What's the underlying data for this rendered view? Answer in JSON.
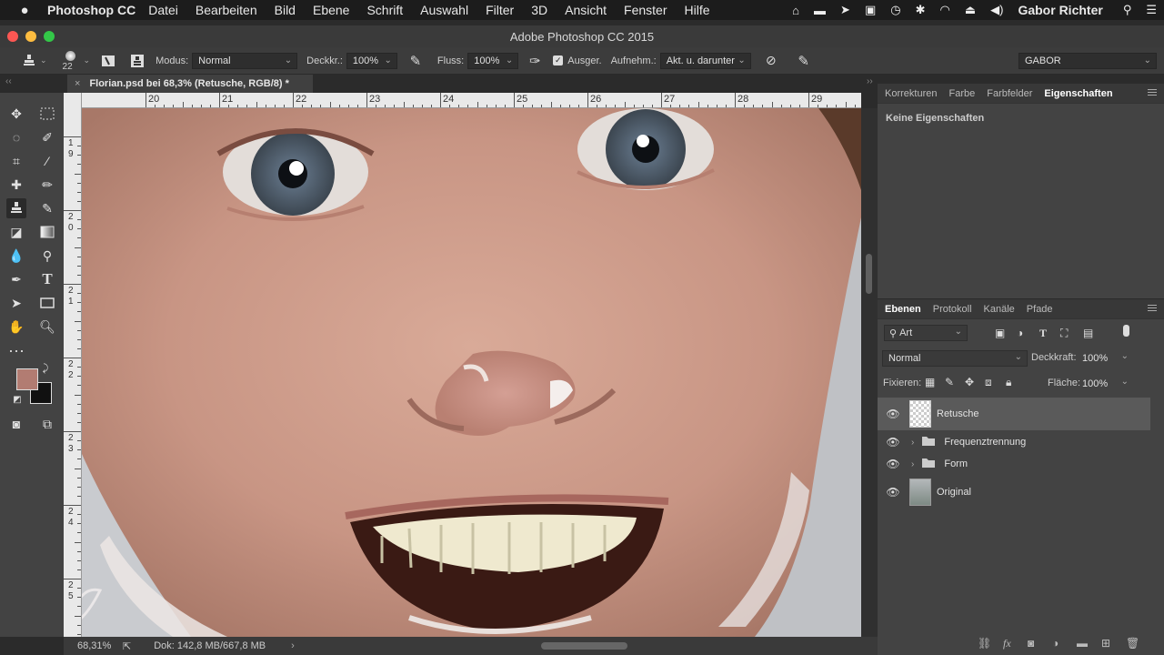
{
  "macmenu": {
    "apple": "",
    "app": "Photoshop CC",
    "items": [
      "Datei",
      "Bearbeiten",
      "Bild",
      "Ebene",
      "Schrift",
      "Auswahl",
      "Filter",
      "3D",
      "Ansicht",
      "Fenster",
      "Hilfe"
    ],
    "user": "Gabor Richter"
  },
  "window": {
    "title": "Adobe Photoshop CC 2015"
  },
  "options": {
    "brush_size": "22",
    "mode_label": "Modus:",
    "mode_value": "Normal",
    "opacity_label": "Deckkr.:",
    "opacity_value": "100%",
    "flow_label": "Fluss:",
    "flow_value": "100%",
    "aligned_label": "Ausger.",
    "sample_label": "Aufnehm.:",
    "sample_value": "Akt. u. darunter",
    "workspace": "GABOR"
  },
  "document": {
    "tab": "Florian.psd bei 68,3% (Retusche, RGB/8) *"
  },
  "ruler": {
    "top": [
      "20",
      "21",
      "22",
      "23",
      "24",
      "25",
      "26",
      "27",
      "28",
      "29"
    ],
    "left": [
      "1 9",
      "2 0",
      "2 1",
      "2 2",
      "2 3",
      "2 4",
      "2 5"
    ]
  },
  "status": {
    "zoom": "68,31%",
    "doc": "Dok: 142,8 MB/667,8 MB"
  },
  "properties": {
    "tabs": [
      "Korrekturen",
      "Farbe",
      "Farbfelder",
      "Eigenschaften"
    ],
    "active_tab": "Eigenschaften",
    "empty": "Keine Eigenschaften"
  },
  "layers": {
    "tabs": [
      "Ebenen",
      "Protokoll",
      "Kanäle",
      "Pfade"
    ],
    "active_tab": "Ebenen",
    "filter": "Art",
    "blend": "Normal",
    "opacity_label": "Deckkraft:",
    "opacity_value": "100%",
    "lock_label": "Fixieren:",
    "fill_label": "Fläche:",
    "fill_value": "100%",
    "items": [
      {
        "name": "Retusche",
        "type": "layer",
        "selected": true
      },
      {
        "name": "Frequenztrennung",
        "type": "group"
      },
      {
        "name": "Form",
        "type": "group"
      },
      {
        "name": "Original",
        "type": "smart"
      }
    ]
  },
  "colors": {
    "foreground": "#b27c72",
    "background": "#111111",
    "accent_selected": "#5a5a5a"
  }
}
